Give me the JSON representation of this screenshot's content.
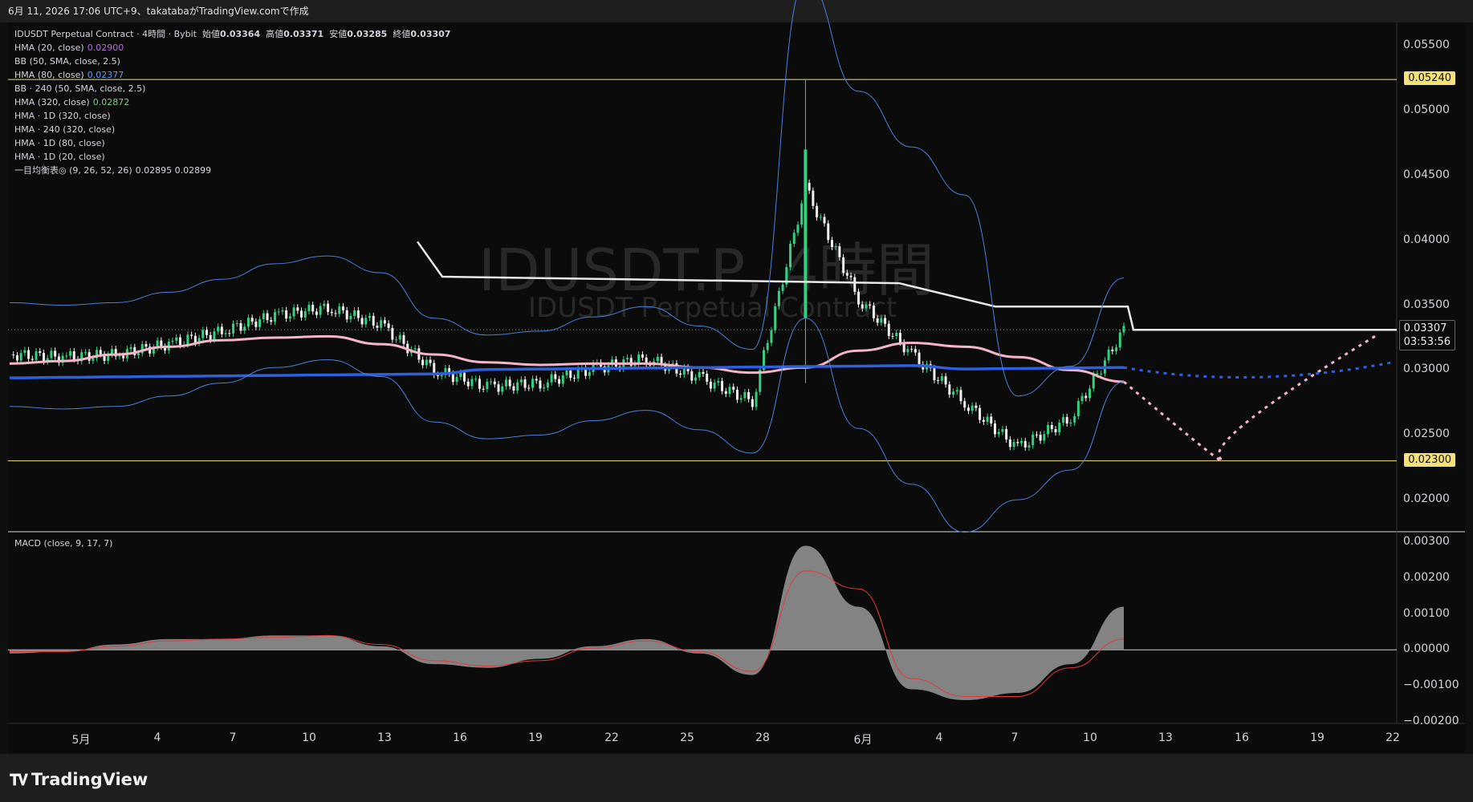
{
  "header": {
    "text": "6月 11, 2026 17:06 UTC+9、takatabaがTradingView.comで作成"
  },
  "legend": {
    "symbol_line": "IDUSDT Perpetual Contract · 4時間 · Bybit",
    "ohlc": [
      {
        "label": "始値",
        "value": "0.03364"
      },
      {
        "label": "高値",
        "value": "0.03371"
      },
      {
        "label": "安値",
        "value": "0.03285"
      },
      {
        "label": "終値",
        "value": "0.03307"
      }
    ],
    "indicators": [
      {
        "label": "HMA (20, close)",
        "value": "0.02900",
        "color": "#b06fd6"
      },
      {
        "label": "BB (50, SMA, close, 2.5)",
        "value": "",
        "color": "#d1d4dc"
      },
      {
        "label": "HMA (80, close)",
        "value": "0.02377",
        "color": "#5b9cf0"
      },
      {
        "label": "BB · 240 (50, SMA, close, 2.5)",
        "value": "",
        "color": "#d1d4dc"
      },
      {
        "label": "HMA (320, close)",
        "value": "0.02872",
        "color": "#7ccf7c"
      },
      {
        "label": "HMA · 1D (320, close)",
        "value": "",
        "color": "#d1d4dc"
      },
      {
        "label": "HMA · 240 (320, close)",
        "value": "",
        "color": "#d1d4dc"
      },
      {
        "label": "HMA · 1D (80, close)",
        "value": "",
        "color": "#d1d4dc"
      },
      {
        "label": "HMA · 1D (20, close)",
        "value": "",
        "color": "#d1d4dc"
      },
      {
        "label": "一目均衡表◎ (9, 26, 52, 26)",
        "value": "0.02895  0.02899",
        "color": "#d1d4dc"
      }
    ],
    "macd_label": "MACD (close, 9, 17, 7)"
  },
  "watermark": {
    "symbol": "IDUSDT.P, 4時間",
    "description": "IDUSDT Perpetual Contract"
  },
  "price_axis": {
    "ticks": [
      "0.05500",
      "0.05000",
      "0.04500",
      "0.04000",
      "0.03500",
      "0.03000",
      "0.02500",
      "0.02000"
    ],
    "current_price": "0.03307",
    "countdown": "03:53:56",
    "levels": [
      {
        "value": "0.05240",
        "color": "#f5e17a"
      },
      {
        "value": "0.02300",
        "color": "#f5e17a"
      }
    ]
  },
  "macd_axis": {
    "ticks": [
      "0.00300",
      "0.00200",
      "0.00100",
      "0.00000",
      "−0.00100",
      "−0.00200"
    ]
  },
  "time_axis": {
    "ticks": [
      "5月",
      "4",
      "7",
      "10",
      "13",
      "16",
      "19",
      "22",
      "25",
      "28",
      "6月",
      "4",
      "7",
      "10",
      "13",
      "16",
      "19",
      "22"
    ]
  },
  "branding": {
    "name": "TradingView"
  },
  "chart_data": {
    "type": "candlestick",
    "symbol": "IDUSDT.P",
    "interval": "4時間",
    "exchange": "Bybit",
    "ylim": [
      0.0176,
      0.0568
    ],
    "macd_ylim": [
      -0.00205,
      0.00318
    ],
    "horizontal_levels": [
      0.0524,
      0.023
    ],
    "price_series": {
      "x": [
        "5月1",
        "5月3",
        "5月5",
        "5月7",
        "5月9",
        "5月11",
        "5月13",
        "5月15",
        "5月17",
        "5月19",
        "5月21",
        "5月23",
        "5月25",
        "5月27",
        "5月29",
        "5月31",
        "6月2",
        "6月4",
        "6月6",
        "6月8",
        "6月10",
        "6月11"
      ],
      "close": [
        0.0312,
        0.031,
        0.0312,
        0.032,
        0.033,
        0.0342,
        0.0348,
        0.0335,
        0.03,
        0.0287,
        0.029,
        0.0301,
        0.0309,
        0.0294,
        0.0276,
        0.044,
        0.0355,
        0.0312,
        0.0275,
        0.024,
        0.0263,
        0.0331
      ]
    },
    "spike": {
      "date": "5月31",
      "high": 0.0524,
      "close": 0.047
    },
    "hma_320": [
      0.0305,
      0.0307,
      0.0312,
      0.0318,
      0.0323,
      0.0325,
      0.0326,
      0.032,
      0.0312,
      0.0306,
      0.0304,
      0.0305,
      0.0305,
      0.0302,
      0.0298,
      0.0302,
      0.0315,
      0.0321,
      0.0318,
      0.031,
      0.03,
      0.0291
    ],
    "hma_80_current_value": 0.02377,
    "macd": {
      "histogram": [
        -0.0001,
        -5e-05,
        0.00015,
        0.0003,
        0.0003,
        0.0004,
        0.0004,
        0.0001,
        -0.0004,
        -0.0005,
        -0.00025,
        0.0001,
        0.0003,
        -0.0001,
        -0.0007,
        0.0029,
        0.0012,
        -0.0011,
        -0.0014,
        -0.0012,
        -0.0004,
        0.0012
      ],
      "signal": [
        -5e-05,
        -5e-05,
        0.0001,
        0.00025,
        0.0003,
        0.00035,
        0.0004,
        0.00015,
        -0.0003,
        -0.00045,
        -0.0003,
        5e-05,
        0.00025,
        -5e-05,
        -0.0006,
        0.0022,
        0.0017,
        -0.0008,
        -0.0013,
        -0.0013,
        -0.0005,
        0.0003
      ]
    }
  }
}
